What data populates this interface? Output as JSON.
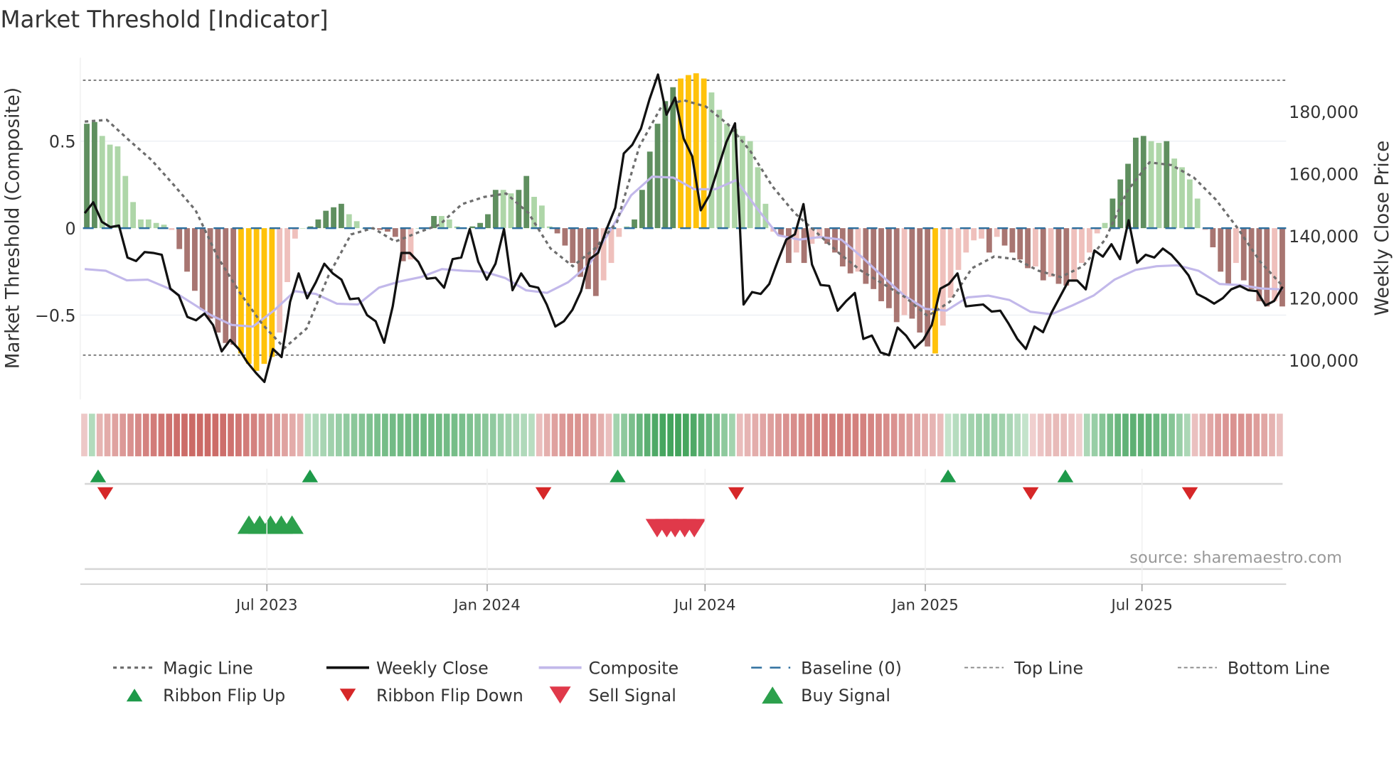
{
  "chart_data": {
    "type": "bar",
    "title": "Market Threshold [Indicator]",
    "ylabel_left": "Market Threshold (Composite)",
    "ylabel_right": "Weekly Close Price",
    "source": "source: sharemaestro.com",
    "ylim_left": [
      -0.98,
      0.98
    ],
    "ylim_right": [
      85000,
      196000
    ],
    "left_ticks": [
      {
        "v": 0.5,
        "label": "0.5"
      },
      {
        "v": 0,
        "label": "0"
      },
      {
        "v": -0.5,
        "label": "−0.5"
      }
    ],
    "right_ticks": [
      {
        "v": 180000,
        "label": "180,000"
      },
      {
        "v": 160000,
        "label": "160,000"
      },
      {
        "v": 140000,
        "label": "140,000"
      },
      {
        "v": 120000,
        "label": "120,000"
      },
      {
        "v": 100000,
        "label": "100,000"
      }
    ],
    "x_ticks": [
      {
        "date": "2023-07-01",
        "label": "Jul 2023"
      },
      {
        "date": "2024-01-01",
        "label": "Jan 2024"
      },
      {
        "date": "2024-07-01",
        "label": "Jul 2024"
      },
      {
        "date": "2025-01-01",
        "label": "Jan 2025"
      },
      {
        "date": "2025-07-01",
        "label": "Jul 2025"
      }
    ],
    "x_range": [
      "2023-02-06",
      "2025-11-10"
    ],
    "top_line": 0.85,
    "bottom_line": -0.73,
    "baseline": 0,
    "extreme_threshold": 0.69,
    "colors": {
      "pos_dark": "#5f8f5f",
      "pos_light": "#aed6a8",
      "neg_dark": "#a87571",
      "neg_light": "#efc0bc",
      "extreme": "#ffc20a",
      "close": "#111111",
      "composite": "#c2b8ea",
      "magic": "#6e6e6e",
      "baseline": "#2e6f9e",
      "flip_up": "#1e9a4a",
      "flip_down": "#d62728",
      "sell": "#e0394a",
      "buy": "#2ca04c"
    },
    "composite_bars": [
      0.6,
      0.61,
      0.53,
      0.48,
      0.47,
      0.3,
      0.15,
      0.05,
      0.05,
      0.03,
      0.02,
      -0.01,
      -0.12,
      -0.25,
      -0.36,
      -0.47,
      -0.52,
      -0.6,
      -0.66,
      -0.67,
      -0.72,
      -0.78,
      -0.82,
      -0.78,
      -0.74,
      -0.6,
      -0.31,
      -0.06,
      0,
      0.01,
      0.05,
      0.1,
      0.12,
      0.14,
      0.08,
      0.04,
      0,
      0,
      -0.01,
      -0.02,
      -0.05,
      -0.19,
      -0.18,
      0,
      0,
      0.07,
      0.07,
      0.05,
      0.01,
      0,
      0.01,
      0.03,
      0.08,
      0.22,
      0.22,
      0.2,
      0.22,
      0.3,
      0.18,
      0.13,
      0.01,
      -0.03,
      -0.1,
      -0.2,
      -0.28,
      -0.35,
      -0.39,
      -0.3,
      -0.2,
      -0.05,
      0.01,
      0.05,
      0.22,
      0.44,
      0.6,
      0.73,
      0.81,
      0.86,
      0.88,
      0.89,
      0.86,
      0.78,
      0.68,
      0.6,
      0.57,
      0.53,
      0.5,
      0.35,
      0.14,
      -0.02,
      -0.04,
      -0.2,
      -0.14,
      -0.2,
      -0.09,
      -0.06,
      -0.09,
      -0.14,
      -0.22,
      -0.26,
      -0.25,
      -0.32,
      -0.35,
      -0.42,
      -0.46,
      -0.54,
      -0.5,
      -0.52,
      -0.6,
      -0.68,
      -0.72,
      -0.56,
      -0.4,
      -0.24,
      -0.14,
      -0.07,
      -0.06,
      -0.14,
      -0.05,
      -0.1,
      -0.14,
      -0.18,
      -0.23,
      -0.22,
      -0.3,
      -0.28,
      -0.32,
      -0.33,
      -0.3,
      -0.2,
      -0.14,
      -0.03,
      0.03,
      0.17,
      0.28,
      0.37,
      0.52,
      0.53,
      0.5,
      0.49,
      0.5,
      0.4,
      0.35,
      0.28,
      0.17,
      -0.01,
      -0.11,
      -0.25,
      -0.32,
      -0.2,
      -0.3,
      -0.35,
      -0.42,
      -0.45,
      -0.42,
      -0.45
    ],
    "weekly_close": [
      147400,
      150900,
      144600,
      142900,
      143400,
      133100,
      132000,
      134900,
      134600,
      134000,
      123100,
      120900,
      114000,
      112900,
      115100,
      111400,
      102900,
      106600,
      103700,
      99400,
      96000,
      93100,
      103700,
      101100,
      118900,
      128000,
      120000,
      125100,
      131100,
      128000,
      126000,
      119700,
      120000,
      114600,
      112600,
      105700,
      117400,
      134600,
      134600,
      131700,
      126300,
      126600,
      123400,
      132600,
      133100,
      142300,
      131700,
      126000,
      131100,
      142300,
      122600,
      128000,
      124000,
      123400,
      118000,
      110900,
      112600,
      116300,
      122300,
      132600,
      134600,
      142300,
      149100,
      166600,
      169400,
      174600,
      184000,
      192000,
      179100,
      184600,
      171400,
      165700,
      148300,
      153100,
      161700,
      170300,
      176300,
      118000,
      122000,
      121400,
      124600,
      132000,
      138900,
      140600,
      150300,
      130900,
      124300,
      124000,
      116000,
      119100,
      121700,
      106900,
      108000,
      102600,
      101700,
      110600,
      108000,
      104000,
      106600,
      111400,
      123100,
      124600,
      128000,
      117400,
      117700,
      118000,
      115700,
      116000,
      111700,
      106900,
      103700,
      110900,
      109100,
      115400,
      120600,
      125700,
      125700,
      122900,
      135400,
      133400,
      137400,
      132600,
      145100,
      131400,
      134000,
      133100,
      136000,
      134000,
      130900,
      127400,
      121400,
      120000,
      118300,
      120000,
      122900,
      124000,
      122600,
      122300,
      117700,
      119100,
      123700
    ],
    "composite_line": [
      -0.235,
      -0.245,
      -0.3,
      -0.296,
      -0.347,
      -0.423,
      -0.5,
      -0.556,
      -0.566,
      -0.474,
      -0.362,
      -0.378,
      -0.434,
      -0.439,
      -0.342,
      -0.306,
      -0.281,
      -0.235,
      -0.245,
      -0.25,
      -0.286,
      -0.357,
      -0.372,
      -0.311,
      -0.209,
      -0.015,
      0.189,
      0.296,
      0.291,
      0.224,
      0.224,
      0.276,
      0.112,
      -0.041,
      -0.066,
      -0.051,
      -0.066,
      -0.168,
      -0.281,
      -0.388,
      -0.464,
      -0.474,
      -0.398,
      -0.388,
      -0.413,
      -0.48,
      -0.495,
      -0.444,
      -0.388,
      -0.296,
      -0.24,
      -0.219,
      -0.214,
      -0.245,
      -0.321,
      -0.327,
      -0.347,
      -0.352
    ],
    "magic_line": [
      0.612,
      0.622,
      0.505,
      0.393,
      0.25,
      0.102,
      -0.168,
      -0.372,
      -0.551,
      -0.689,
      -0.577,
      -0.27,
      -0.036,
      0,
      -0.077,
      -0.026,
      0.02,
      0.138,
      0.179,
      0.199,
      0.087,
      -0.117,
      -0.219,
      -0.117,
      0.036,
      0.469,
      0.699,
      0.735,
      0.699,
      0.597,
      0.444,
      0.24,
      0.087,
      -0.026,
      -0.143,
      -0.245,
      -0.321,
      -0.398,
      -0.505,
      -0.423,
      -0.23,
      -0.163,
      -0.179,
      -0.245,
      -0.281,
      -0.219,
      -0.066,
      0.214,
      0.378,
      0.362,
      0.291,
      0.163,
      -0.005,
      -0.194,
      -0.332
    ],
    "ribbon_segments": [
      {
        "n": 1,
        "sign": -1,
        "peak": 0.2
      },
      {
        "n": 1,
        "sign": 1,
        "peak": 0.3
      },
      {
        "n": 27,
        "sign": -1,
        "peak": 0.9
      },
      {
        "n": 30,
        "sign": 1,
        "peak": 0.7
      },
      {
        "n": 10,
        "sign": -1,
        "peak": 0.6
      },
      {
        "n": 16,
        "sign": 1,
        "peak": 0.95
      },
      {
        "n": 27,
        "sign": -1,
        "peak": 0.75
      },
      {
        "n": 11,
        "sign": 1,
        "peak": 0.45
      },
      {
        "n": 7,
        "sign": -1,
        "peak": 0.3
      },
      {
        "n": 14,
        "sign": 1,
        "peak": 0.8
      },
      {
        "n": 12,
        "sign": -1,
        "peak": 0.6
      }
    ],
    "ribbon_flip_up": [
      "2023-02-10",
      "2023-08-06",
      "2024-04-19",
      "2025-01-20",
      "2025-04-28"
    ],
    "ribbon_flip_down": [
      "2023-02-16",
      "2024-02-17",
      "2024-07-27",
      "2025-03-30",
      "2025-08-10"
    ],
    "buy_signals": [
      "2023-06-16",
      "2023-06-25",
      "2023-07-04",
      "2023-07-13",
      "2023-07-22"
    ],
    "sell_signals": [
      "2024-05-22",
      "2024-05-30",
      "2024-06-06",
      "2024-06-14",
      "2024-06-22"
    ],
    "legend": {
      "placement": "bottom",
      "items": [
        "Magic Line",
        "Weekly Close",
        "Composite",
        "Baseline (0)",
        "Top Line",
        "Bottom Line",
        "Ribbon Flip Up",
        "Ribbon Flip Down",
        "Sell Signal",
        "Buy Signal"
      ]
    }
  }
}
